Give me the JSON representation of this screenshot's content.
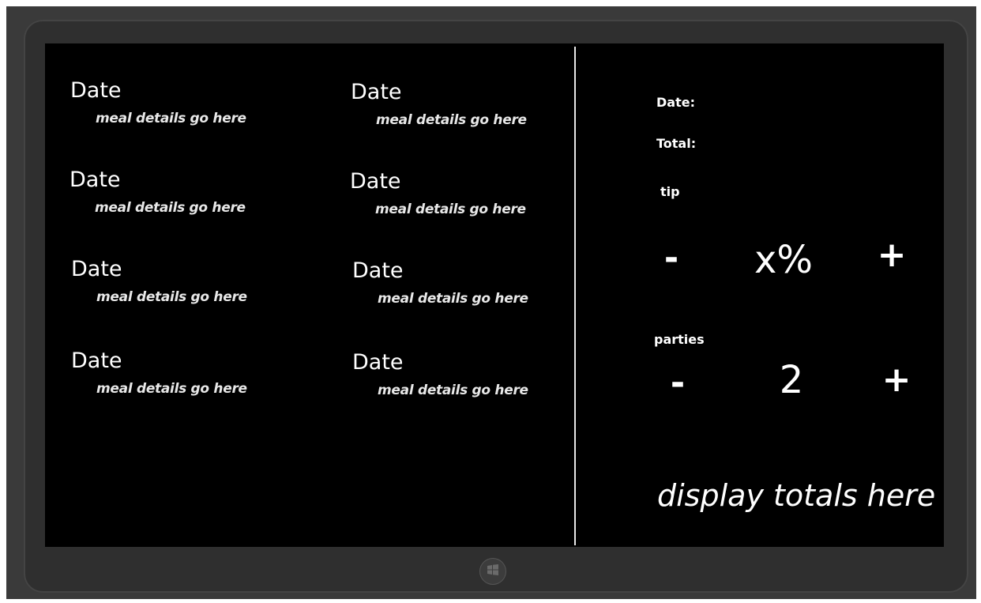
{
  "meals": [
    {
      "date": "Date",
      "details": "meal details go here"
    },
    {
      "date": "Date",
      "details": "meal details go here"
    },
    {
      "date": "Date",
      "details": "meal details go here"
    },
    {
      "date": "Date",
      "details": "meal details go here"
    },
    {
      "date": "Date",
      "details": "meal details go here"
    },
    {
      "date": "Date",
      "details": "meal details go here"
    },
    {
      "date": "Date",
      "details": "meal details go here"
    },
    {
      "date": "Date",
      "details": "meal details go here"
    }
  ],
  "summary": {
    "date_label": "Date:",
    "total_label": "Total:",
    "tip_label": "tip",
    "tip_minus": "-",
    "tip_value": "x%",
    "tip_plus": "+",
    "parties_label": "parties",
    "parties_minus": "-",
    "parties_value": "2",
    "parties_plus": "+",
    "totals_text": "display totals here"
  },
  "icons": {
    "start_button": "windows-logo-icon"
  },
  "colors": {
    "screen_background": "#000000",
    "text": "#ffffff",
    "bezel": "#2f2f2f"
  }
}
